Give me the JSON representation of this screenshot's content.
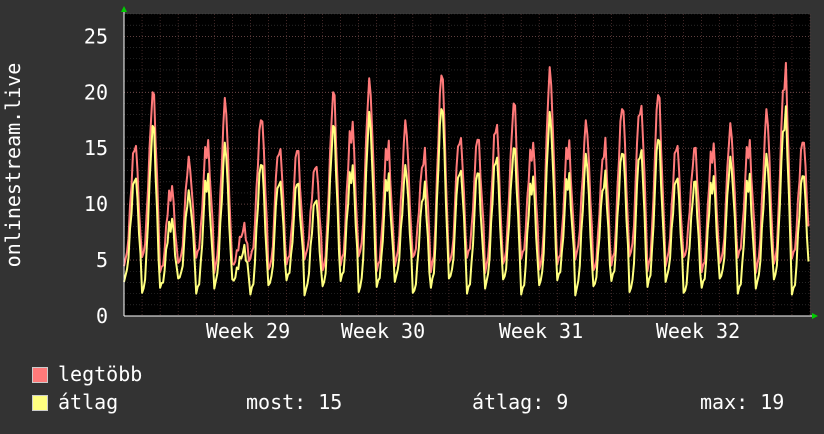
{
  "chart_data": {
    "type": "line",
    "ylabel": "onlinestream.live",
    "ylim": [
      0,
      27
    ],
    "yticks": [
      0,
      5,
      10,
      15,
      20,
      25
    ],
    "x_tick_labels": [
      "Week 29",
      "Week 30",
      "Week 31",
      "Week 32"
    ],
    "grid": true,
    "colors": {
      "background": "#333333",
      "plot_background": "#000000",
      "grid": "#5a5a5a",
      "max_series": "#ff7a7a",
      "avg_series": "#ffff80",
      "axis_arrow": "#00cc00"
    },
    "series": [
      {
        "name": "legtöbb",
        "color": "#ff7a7a",
        "daily_peaks": [
          16,
          20,
          12,
          14,
          16,
          19,
          8,
          18,
          16,
          15,
          14,
          20,
          18,
          21,
          16,
          17,
          15,
          22,
          17,
          16,
          18,
          19,
          16,
          22,
          16,
          17,
          16,
          19,
          20,
          20,
          16,
          15,
          16,
          17,
          16,
          18,
          23,
          16
        ]
      },
      {
        "name": "átlag",
        "color": "#ffff80",
        "daily_peaks": [
          13,
          17,
          9,
          11,
          13,
          15,
          6,
          14,
          13,
          12,
          11,
          17,
          14,
          18,
          13,
          13,
          12,
          19,
          14,
          13,
          15,
          15,
          13,
          18,
          13,
          14,
          13,
          15,
          16,
          16,
          13,
          12,
          13,
          14,
          13,
          14,
          19,
          13
        ]
      }
    ]
  },
  "legend": {
    "items": [
      {
        "label": "legtöbb",
        "color": "#ff7a7a"
      },
      {
        "label": "átlag",
        "color": "#ffff80"
      }
    ]
  },
  "stats": {
    "most": "most: 15",
    "atlag": "átlag: 9",
    "max": "max: 19"
  }
}
